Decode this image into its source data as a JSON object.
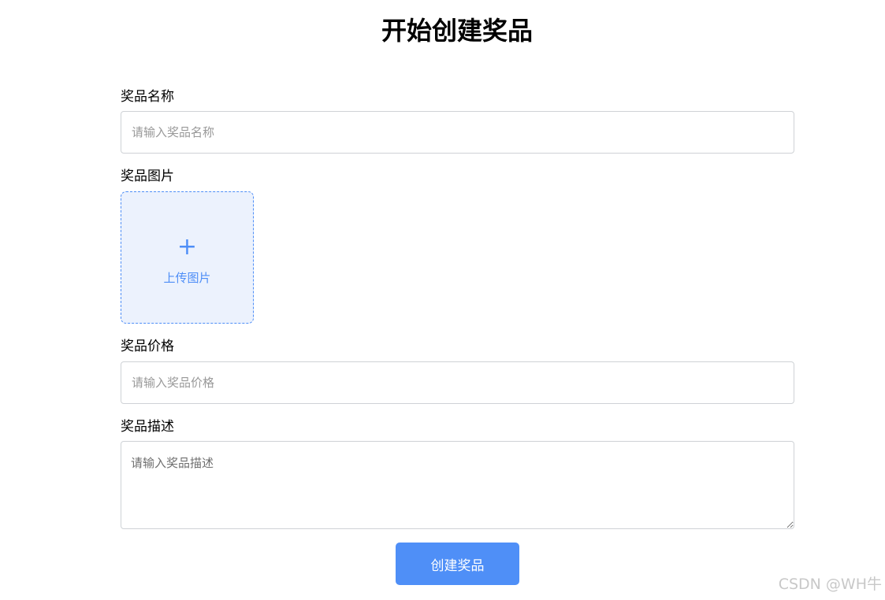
{
  "page": {
    "title": "开始创建奖品"
  },
  "form": {
    "name": {
      "label": "奖品名称",
      "placeholder": "请输入奖品名称",
      "value": ""
    },
    "image": {
      "label": "奖品图片",
      "upload_icon": "plus-icon",
      "upload_text": "上传图片"
    },
    "price": {
      "label": "奖品价格",
      "placeholder": "请输入奖品价格",
      "value": ""
    },
    "description": {
      "label": "奖品描述",
      "placeholder": "请输入奖品描述",
      "value": ""
    },
    "submit_label": "创建奖品"
  },
  "watermark": "CSDN @WH牛",
  "colors": {
    "accent": "#4f8ff7",
    "upload_background": "#ecf2fd",
    "border": "#cfd2d6"
  }
}
